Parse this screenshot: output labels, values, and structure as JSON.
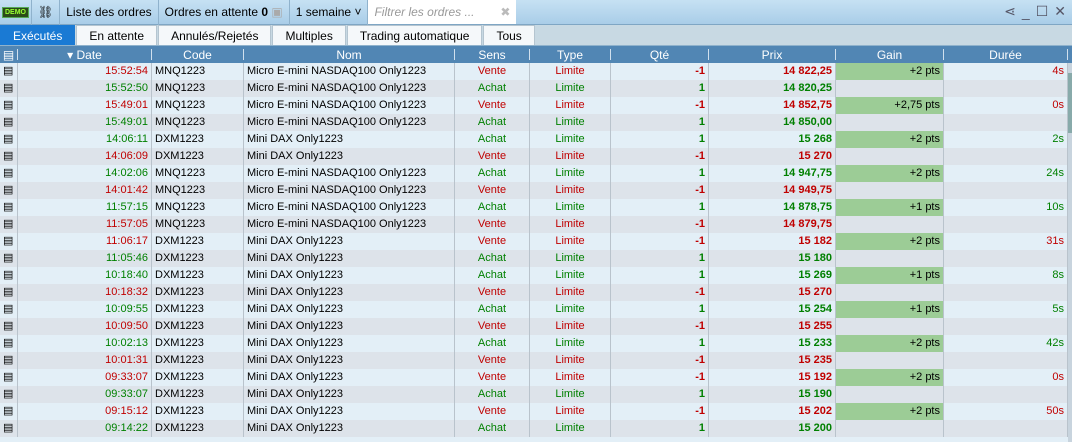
{
  "toolbar": {
    "demo_badge": "DEMO",
    "title": "Liste des ordres",
    "pending_label": "Ordres en attente",
    "pending_count": "0",
    "period": "1 semaine",
    "filter_placeholder": "Filtrer les ordres ..."
  },
  "tabs": [
    "Exécutés",
    "En attente",
    "Annulés/Rejetés",
    "Multiples",
    "Trading automatique",
    "Tous"
  ],
  "columns": [
    "Date",
    "Code",
    "Nom",
    "Sens",
    "Type",
    "Qté",
    "Prix",
    "Gain",
    "Durée"
  ],
  "rows": [
    [
      "15:52:54",
      "MNQ1223",
      "Micro E-mini NASDAQ100 Only1223",
      "Vente",
      "Limite",
      "-1",
      "14 822,25",
      "+2 pts",
      "4s"
    ],
    [
      "15:52:50",
      "MNQ1223",
      "Micro E-mini NASDAQ100 Only1223",
      "Achat",
      "Limite",
      "1",
      "14 820,25",
      "",
      ""
    ],
    [
      "15:49:01",
      "MNQ1223",
      "Micro E-mini NASDAQ100 Only1223",
      "Vente",
      "Limite",
      "-1",
      "14 852,75",
      "+2,75 pts",
      "0s"
    ],
    [
      "15:49:01",
      "MNQ1223",
      "Micro E-mini NASDAQ100 Only1223",
      "Achat",
      "Limite",
      "1",
      "14 850,00",
      "",
      ""
    ],
    [
      "14:06:11",
      "DXM1223",
      "Mini DAX Only1223",
      "Achat",
      "Limite",
      "1",
      "15 268",
      "+2 pts",
      "2s"
    ],
    [
      "14:06:09",
      "DXM1223",
      "Mini DAX Only1223",
      "Vente",
      "Limite",
      "-1",
      "15 270",
      "",
      ""
    ],
    [
      "14:02:06",
      "MNQ1223",
      "Micro E-mini NASDAQ100 Only1223",
      "Achat",
      "Limite",
      "1",
      "14 947,75",
      "+2 pts",
      "24s"
    ],
    [
      "14:01:42",
      "MNQ1223",
      "Micro E-mini NASDAQ100 Only1223",
      "Vente",
      "Limite",
      "-1",
      "14 949,75",
      "",
      ""
    ],
    [
      "11:57:15",
      "MNQ1223",
      "Micro E-mini NASDAQ100 Only1223",
      "Achat",
      "Limite",
      "1",
      "14 878,75",
      "+1 pts",
      "10s"
    ],
    [
      "11:57:05",
      "MNQ1223",
      "Micro E-mini NASDAQ100 Only1223",
      "Vente",
      "Limite",
      "-1",
      "14 879,75",
      "",
      ""
    ],
    [
      "11:06:17",
      "DXM1223",
      "Mini DAX Only1223",
      "Vente",
      "Limite",
      "-1",
      "15 182",
      "+2 pts",
      "31s"
    ],
    [
      "11:05:46",
      "DXM1223",
      "Mini DAX Only1223",
      "Achat",
      "Limite",
      "1",
      "15 180",
      "",
      ""
    ],
    [
      "10:18:40",
      "DXM1223",
      "Mini DAX Only1223",
      "Achat",
      "Limite",
      "1",
      "15 269",
      "+1 pts",
      "8s"
    ],
    [
      "10:18:32",
      "DXM1223",
      "Mini DAX Only1223",
      "Vente",
      "Limite",
      "-1",
      "15 270",
      "",
      ""
    ],
    [
      "10:09:55",
      "DXM1223",
      "Mini DAX Only1223",
      "Achat",
      "Limite",
      "1",
      "15 254",
      "+1 pts",
      "5s"
    ],
    [
      "10:09:50",
      "DXM1223",
      "Mini DAX Only1223",
      "Vente",
      "Limite",
      "-1",
      "15 255",
      "",
      ""
    ],
    [
      "10:02:13",
      "DXM1223",
      "Mini DAX Only1223",
      "Achat",
      "Limite",
      "1",
      "15 233",
      "+2 pts",
      "42s"
    ],
    [
      "10:01:31",
      "DXM1223",
      "Mini DAX Only1223",
      "Vente",
      "Limite",
      "-1",
      "15 235",
      "",
      ""
    ],
    [
      "09:33:07",
      "DXM1223",
      "Mini DAX Only1223",
      "Vente",
      "Limite",
      "-1",
      "15 192",
      "+2 pts",
      "0s"
    ],
    [
      "09:33:07",
      "DXM1223",
      "Mini DAX Only1223",
      "Achat",
      "Limite",
      "1",
      "15 190",
      "",
      ""
    ],
    [
      "09:15:12",
      "DXM1223",
      "Mini DAX Only1223",
      "Vente",
      "Limite",
      "-1",
      "15 202",
      "+2 pts",
      "50s"
    ],
    [
      "09:14:22",
      "DXM1223",
      "Mini DAX Only1223",
      "Achat",
      "Limite",
      "1",
      "15 200",
      "",
      ""
    ]
  ]
}
